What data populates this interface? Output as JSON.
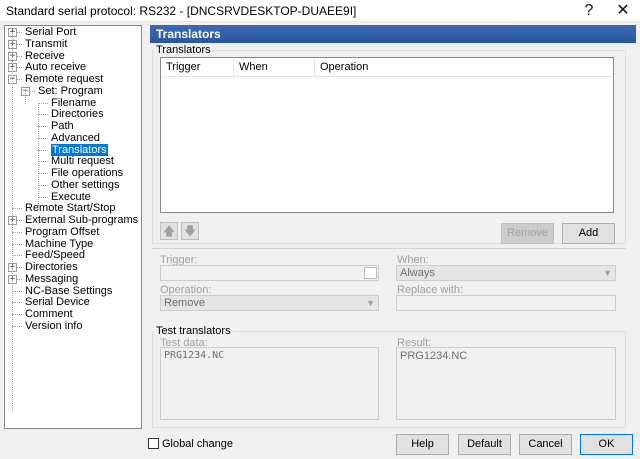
{
  "window": {
    "title": "Standard serial protocol: RS232 - [DNCSRVDESKTOP-DUAEE9I]",
    "help_glyph": "?",
    "close_glyph": "✕"
  },
  "tree": {
    "items": [
      {
        "label": "Serial Port",
        "expander": "+"
      },
      {
        "label": "Transmit",
        "expander": "+"
      },
      {
        "label": "Receive",
        "expander": "+"
      },
      {
        "label": "Auto receive",
        "expander": "+"
      },
      {
        "label": "Remote request",
        "expander": "−"
      },
      {
        "label": "Set: Program",
        "expander": "−"
      },
      {
        "label": "Filename"
      },
      {
        "label": "Directories"
      },
      {
        "label": "Path"
      },
      {
        "label": "Advanced"
      },
      {
        "label": "Translators",
        "selected": true
      },
      {
        "label": "Multi request"
      },
      {
        "label": "File operations"
      },
      {
        "label": "Other settings"
      },
      {
        "label": "Execute"
      },
      {
        "label": "Remote Start/Stop"
      },
      {
        "label": "External Sub-programs",
        "expander": "+"
      },
      {
        "label": "Program Offset"
      },
      {
        "label": "Machine Type"
      },
      {
        "label": "Feed/Speed"
      },
      {
        "label": "Directories",
        "expander": "+"
      },
      {
        "label": "Messaging",
        "expander": "+"
      },
      {
        "label": "NC-Base Settings"
      },
      {
        "label": "Serial Device"
      },
      {
        "label": "Comment"
      },
      {
        "label": "Version info"
      }
    ]
  },
  "panel": {
    "header": "Translators",
    "translators_group_label": "Translators",
    "columns": [
      "Trigger",
      "When",
      "Operation"
    ],
    "up_glyph": "🡅",
    "down_glyph": "🡇",
    "remove_label": "Remove",
    "add_label": "Add",
    "trigger_label": "Trigger:",
    "trigger_value": "",
    "when_label": "When:",
    "when_value": "Always",
    "operation_label": "Operation:",
    "operation_value": "Remove",
    "replace_label": "Replace with:",
    "replace_value": "",
    "test_group_label": "Test translators",
    "test_data_label": "Test data:",
    "test_data_value": "PRG1234.NC",
    "result_label": "Result:",
    "result_value": "PRG1234.NC"
  },
  "footer": {
    "global_change_label": "Global change",
    "help_label": "Help",
    "default_label": "Default",
    "cancel_label": "Cancel",
    "ok_label": "OK"
  }
}
